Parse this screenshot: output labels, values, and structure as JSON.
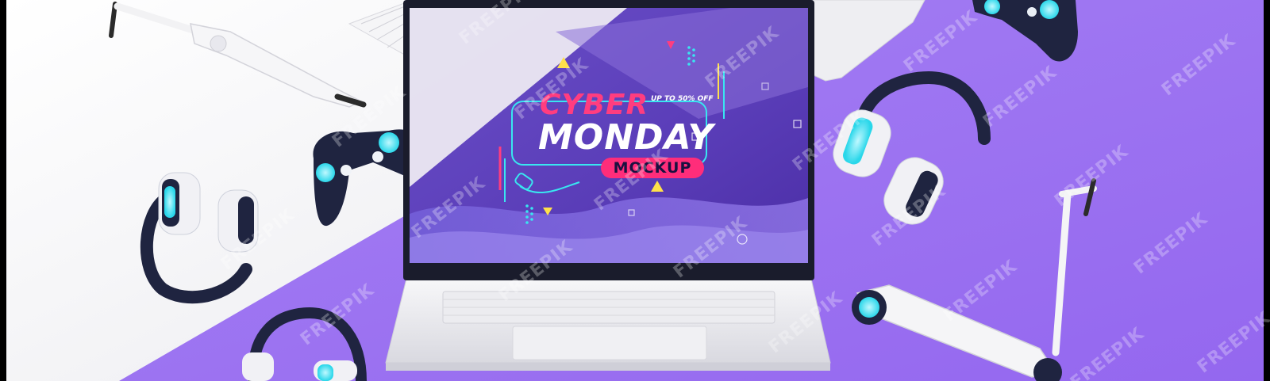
{
  "promo": {
    "headline_top": "CYBER",
    "headline_main": "MONDAY",
    "offer": "UP TO 50% OFF",
    "badge": "MOCKUP"
  },
  "watermark": "FREEPIK",
  "colors": {
    "purple_bg": "#9f76f2",
    "white_bg": "#f3f3f5",
    "accent_pink": "#ff2d7a",
    "accent_cyan": "#39e6f0",
    "device_dark": "#1f2440"
  },
  "objects": [
    "laptop",
    "keyboard",
    "tablet",
    "gamepad",
    "gamepad",
    "headphones",
    "headphones",
    "headphones",
    "scooter",
    "scooter"
  ]
}
